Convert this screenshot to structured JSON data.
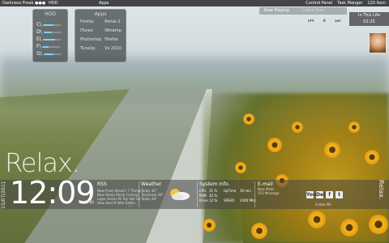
{
  "topbar": {
    "user": "Darkness Freak ●●●",
    "hdd": "HDD",
    "apps": "Apps",
    "control_panel": "Control Panel",
    "task_manager": "Task Manger",
    "items": "120 Item"
  },
  "hdd_panel": {
    "title": "HDD",
    "drives": [
      {
        "label": "C\\",
        "fill_pct": 60
      },
      {
        "label": "D\\",
        "fill_pct": 45
      },
      {
        "label": "E\\",
        "fill_pct": 70
      },
      {
        "label": "F\\",
        "fill_pct": 35
      },
      {
        "label": "G\\",
        "fill_pct": 55
      }
    ]
  },
  "apps_panel": {
    "title": "Apps",
    "items": [
      "Firefox",
      "Portal 2",
      "iTunes",
      "Winamp",
      "Photoshop",
      "Firefox",
      "TuneUp",
      "Vs 2010"
    ]
  },
  "now_playing": {
    "title": "Now Playing",
    "artist": "Celine Dion",
    "song": "In This Life",
    "time": "02:25",
    "controls": [
      "⏮",
      "⏸",
      "⏭"
    ]
  },
  "desktop": {
    "relax": "Relax.",
    "date": "15/07/2011",
    "time": "12:09",
    "ampm": "PM"
  },
  "rss": {
    "title": "RSS",
    "items": [
      "New Fresh Breach 7 Things",
      "Now Yahoo Stock Coming",
      "Layer Hacks At Top Sell Up",
      "How Hard It Was Gettin..."
    ],
    "more": "..."
  },
  "weather": {
    "title": "Weather",
    "rows": [
      {
        "label": "Today",
        "value": "42°"
      },
      {
        "label": "Tomorrow",
        "value": "28°"
      },
      {
        "label": "Today",
        "value": "28°"
      }
    ]
  },
  "system_info": {
    "title": "System Info.",
    "rows": [
      {
        "k": "CPU",
        "v": "31 %",
        "k2": "UpTime",
        "v2": "30 min"
      },
      {
        "k": "RAM",
        "v": "32 %",
        "k2": "",
        "v2": ""
      },
      {
        "k": "Drive",
        "v": "12 %",
        "k2": "SPEED",
        "v2": "2400 Mhz"
      }
    ]
  },
  "email": {
    "title": "E-mail",
    "new_mail": "New Mails",
    "count": "552 Message"
  },
  "social": {
    "icons": [
      "You",
      "Del",
      "f",
      "t"
    ],
    "follow": "Follow Me",
    "vertical": "Relax."
  }
}
